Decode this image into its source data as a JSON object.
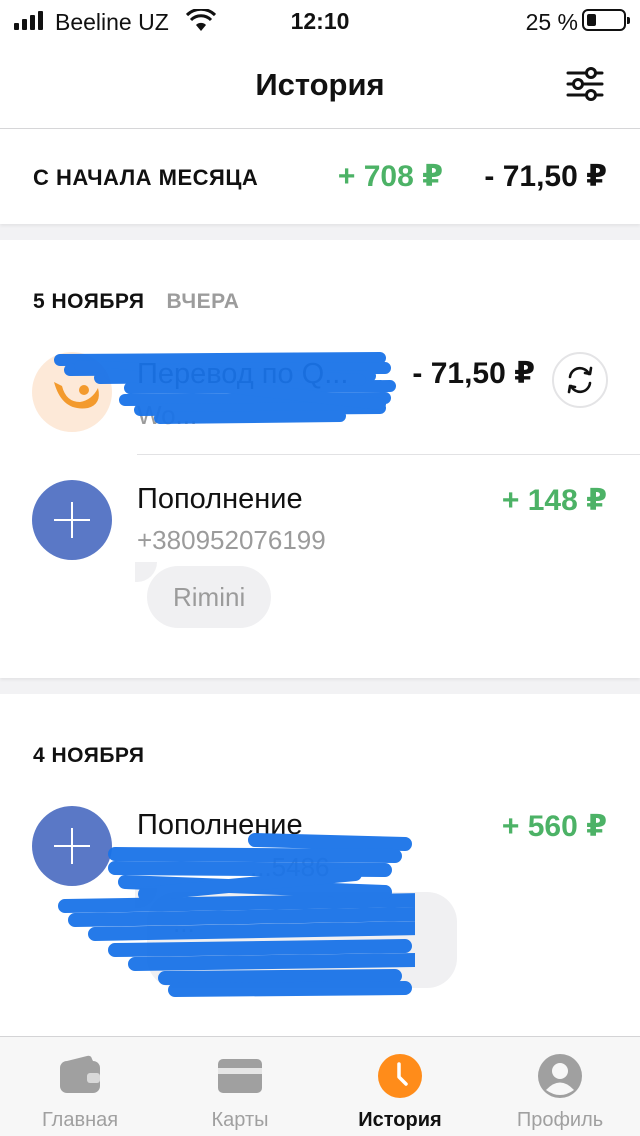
{
  "status_bar": {
    "carrier": "Beeline UZ",
    "time": "12:10",
    "battery_percent": "25 %",
    "battery_level": 0.25
  },
  "header": {
    "title": "История",
    "filter_icon": "sliders-icon"
  },
  "summary": {
    "label": "С НАЧАЛА МЕСЯЦА",
    "income": "+ 708 ₽",
    "expense": "- 71,50 ₽",
    "income_color": "#4cb266"
  },
  "groups": [
    {
      "date": "5 НОЯБРЯ",
      "date_sub": "ВЧЕРА",
      "transactions": [
        {
          "title": "Перевод по Q...",
          "subtitle": "Wo...",
          "amount": "- 71,50 ₽",
          "icon": "merchant-logo-icon",
          "action_icon": "repeat-icon",
          "redacted": true
        },
        {
          "title": "Пополнение",
          "subtitle": "+380952076199",
          "amount": "+ 148 ₽",
          "icon": "plus-icon",
          "comment": "Rimini"
        }
      ]
    },
    {
      "date": "4 НОЯБРЯ",
      "transactions": [
        {
          "title": "Пополнение",
          "subtitle": "...5486",
          "amount": "+ 560 ₽",
          "icon": "plus-icon",
          "comment": "...",
          "redacted": true
        }
      ]
    }
  ],
  "tabs": [
    {
      "label": "Главная",
      "icon": "wallet-icon",
      "active": false
    },
    {
      "label": "Карты",
      "icon": "card-icon",
      "active": false
    },
    {
      "label": "История",
      "icon": "clock-icon",
      "active": true
    },
    {
      "label": "Профиль",
      "icon": "profile-icon",
      "active": false
    }
  ],
  "colors": {
    "accent": "#ff8c1a",
    "positive": "#4cb266",
    "plus_avatar": "#5a78c6",
    "redaction": "#1a73e8"
  }
}
